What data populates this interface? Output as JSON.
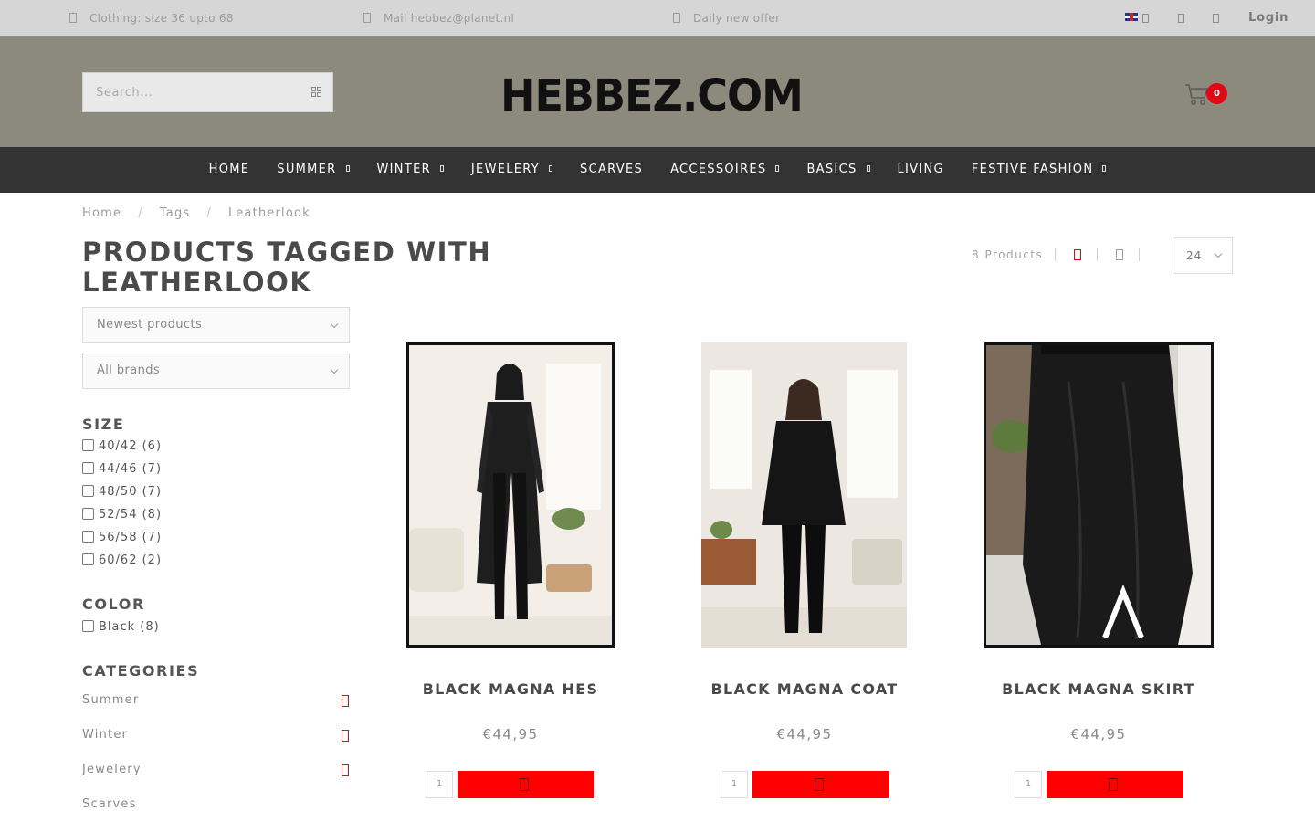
{
  "topbar": {
    "usps": [
      {
        "icon": "tag-icon",
        "text": "Clothing: size 36 upto 68"
      },
      {
        "icon": "mail-icon",
        "text": "Mail hebbez@planet.nl"
      },
      {
        "icon": "tag-icon",
        "text": "Daily new offer"
      }
    ],
    "language_icon": "uk-flag-icon",
    "login_label": "Login"
  },
  "header": {
    "search_placeholder": "Search...",
    "logo_text": "HEBBEZ.COM",
    "cart_count": "0"
  },
  "nav": {
    "items": [
      {
        "label": "HOME",
        "dropdown": false
      },
      {
        "label": "SUMMER",
        "dropdown": true
      },
      {
        "label": "WINTER",
        "dropdown": true
      },
      {
        "label": "JEWELERY",
        "dropdown": true
      },
      {
        "label": "SCARVES",
        "dropdown": false
      },
      {
        "label": "ACCESSOIRES",
        "dropdown": true
      },
      {
        "label": "BASICS",
        "dropdown": true
      },
      {
        "label": "LIVING",
        "dropdown": false
      },
      {
        "label": "FESTIVE FASHION",
        "dropdown": true
      }
    ]
  },
  "breadcrumb": [
    "Home",
    "Tags",
    "Leatherlook"
  ],
  "page_title": "PRODUCTS TAGGED WITH LEATHERLOOK",
  "toolbar": {
    "count_label": "8 Products",
    "per_page": "24"
  },
  "sidebar": {
    "sort_selected": "Newest products",
    "brand_selected": "All brands",
    "size_heading": "SIZE",
    "sizes": [
      "40/42 (6)",
      "44/46 (7)",
      "48/50 (7)",
      "52/54 (8)",
      "56/58 (7)",
      "60/62 (2)"
    ],
    "color_heading": "COLOR",
    "colors": [
      "Black (8)"
    ],
    "categories_heading": "CATEGORIES",
    "categories": [
      {
        "label": "Summer",
        "expandable": true
      },
      {
        "label": "Winter",
        "expandable": true
      },
      {
        "label": "Jewelery",
        "expandable": true
      },
      {
        "label": "Scarves",
        "expandable": false
      }
    ]
  },
  "products": [
    {
      "title": "BLACK MAGNA HES",
      "price": "€44,95",
      "qty": "1"
    },
    {
      "title": "BLACK MAGNA COAT",
      "price": "€44,95",
      "qty": "1"
    },
    {
      "title": "BLACK MAGNA SKIRT",
      "price": "€44,95",
      "qty": "1"
    }
  ],
  "colors": {
    "accent": "#ff0000",
    "nav_bg": "#333333",
    "header_bg": "#8b8a7d",
    "topbar_bg": "#d6d6d6",
    "badge": "#e30613"
  }
}
